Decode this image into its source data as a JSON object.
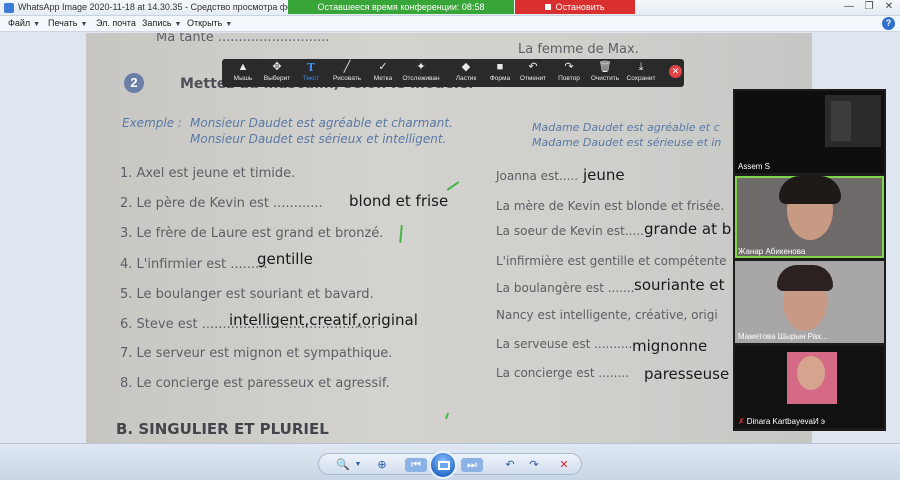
{
  "window": {
    "title": "WhatsApp Image 2020-11-18 at 14.30.35 - Средство просмотра фотографий",
    "conference_timer_label": "Оставшееся время конференции: 08:58",
    "stop_demo_label": "Остановить демонстрацию",
    "controls": {
      "minimize": "—",
      "restore": "❐",
      "close": "✕"
    }
  },
  "menu": {
    "items": [
      {
        "label": "Файл"
      },
      {
        "label": "Печать"
      },
      {
        "label": "Эл. почта"
      },
      {
        "label": "Запись"
      },
      {
        "label": "Открыть"
      }
    ],
    "help_label": "?"
  },
  "annotation_toolbar": {
    "tools": [
      {
        "label": "Мышь",
        "icon": "▲",
        "active": false
      },
      {
        "label": "Выберит",
        "icon": "✥",
        "active": false
      },
      {
        "label": "Текст",
        "icon": "T",
        "active": true
      },
      {
        "label": "Рисовать",
        "icon": "╱",
        "active": false
      },
      {
        "label": "Метка",
        "icon": "✓",
        "active": false
      },
      {
        "label": "Отслеживан",
        "icon": "✦",
        "active": false
      },
      {
        "label": "Ластик",
        "icon": "◆",
        "active": false
      },
      {
        "label": "Форма",
        "icon": "■",
        "active": false
      },
      {
        "label": "Отменит",
        "icon": "↶",
        "active": false
      },
      {
        "label": "Повтор",
        "icon": "↷",
        "active": false
      },
      {
        "label": "Очистить",
        "icon": "🗑",
        "active": false
      },
      {
        "label": "Сохранит",
        "icon": "⤓",
        "active": false
      }
    ],
    "close_label": "✕"
  },
  "document": {
    "top_left": "Ma tante ...........................",
    "top_right": "La femme de Max.",
    "exercise_number": "2",
    "heading": "Mettez au masculin, selon le modèle.",
    "example_label": "Exemple :",
    "example_left_1": "Monsieur Daudet est agréable et charmant.",
    "example_left_2": "Monsieur Daudet est sérieux et intelligent.",
    "example_right_1": "Madame Daudet est agréable et c",
    "example_right_2": "Madame Daudet est sérieuse et in",
    "left_items": [
      "1.  Axel est jeune et timide.",
      "2.  Le père de Kevin est ............",
      "3.  Le frère de Laure est grand et bronzé.",
      "4.  L'infirmier est .........",
      "5.  Le boulanger est souriant et bavard.",
      "6.  Steve est ..........................................",
      "7.  Le serveur est mignon et sympathique.",
      "8.  Le concierge est paresseux et agressif."
    ],
    "right_items": [
      "Joanna est.....",
      "La mère de Kevin est blonde et frisée.",
      "La soeur de Kevin est.....",
      "L'infirmière est gentille et compétente",
      "La boulangère est .......",
      "Nancy est intelligente, créative, origi",
      "La serveuse est ..........",
      "La concierge est ........"
    ],
    "section_b": "B. SINGULIER ET PLURIEL"
  },
  "typed_answers": [
    "blond et frise",
    "jeune",
    "grande at b",
    "gentille",
    "souriante et",
    "intelligent,creatif,original",
    "mignonne",
    "paresseuse"
  ],
  "participants": [
    {
      "name": "Assem S",
      "muted": false
    },
    {
      "name": "Жанар Абикенова",
      "muted": false
    },
    {
      "name": "Маметова Шырын Рах...",
      "muted": false
    },
    {
      "name": "Dinara KartbayevaИ э",
      "muted": true
    }
  ],
  "viewer_controls": {
    "zoom": "🔍",
    "actual_size": "⊕",
    "previous": "⏮",
    "next": "⏭",
    "rotate_left": "↶",
    "rotate_right": "↷",
    "delete": "✕"
  },
  "colors": {
    "timer_green": "#38a538",
    "stop_red": "#d9302f",
    "active_tool_blue": "#3b8ef0",
    "speaker_outline": "#7fd44a"
  }
}
